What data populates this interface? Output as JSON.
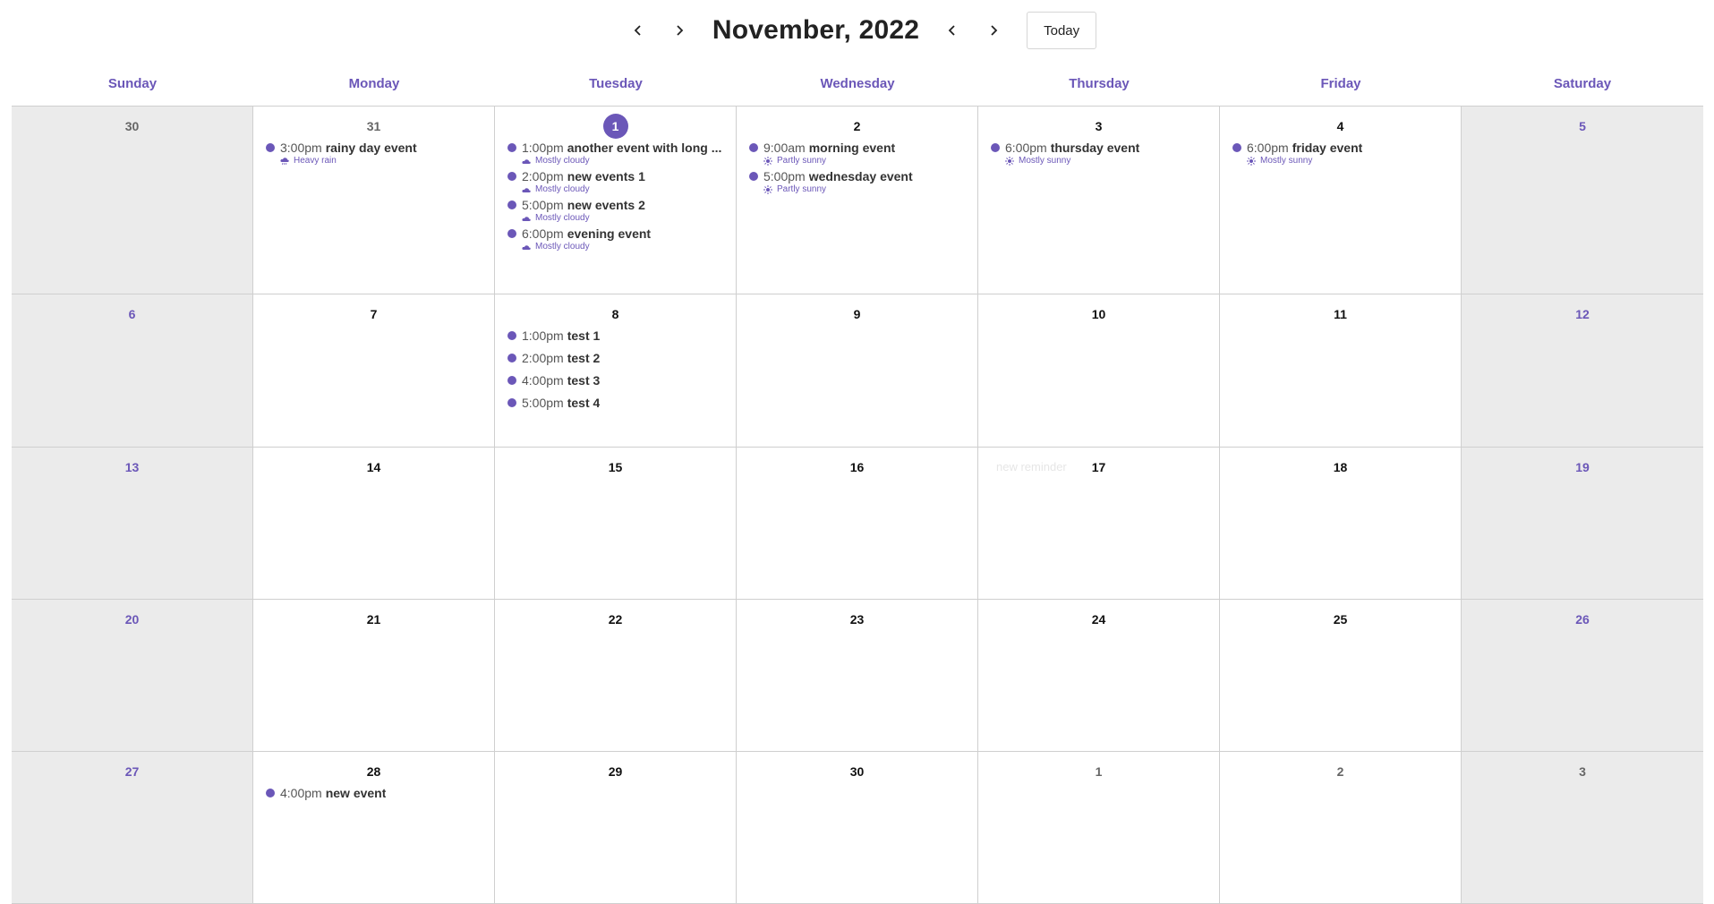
{
  "header": {
    "title": "November, 2022",
    "today_label": "Today",
    "prev_icon": "chevron-left-icon",
    "next_icon": "chevron-right-icon"
  },
  "weekdays": [
    "Sunday",
    "Monday",
    "Tuesday",
    "Wednesday",
    "Thursday",
    "Friday",
    "Saturday"
  ],
  "colors": {
    "accent": "#6b57b8",
    "weekend_bg": "#ebebeb",
    "border": "#cfcfcf"
  },
  "weeks": [
    [
      {
        "day": "30",
        "other": true,
        "weekend": true,
        "events": []
      },
      {
        "day": "31",
        "other": true,
        "events": [
          {
            "time": "3:00pm",
            "title": "rainy day event",
            "weather": "Heavy rain",
            "weather_icon": "rain-cloud-icon"
          }
        ]
      },
      {
        "day": "1",
        "today": true,
        "events": [
          {
            "time": "1:00pm",
            "title": "another event with long ...",
            "weather": "Mostly cloudy",
            "weather_icon": "cloud-icon"
          },
          {
            "time": "2:00pm",
            "title": "new events 1",
            "weather": "Mostly cloudy",
            "weather_icon": "cloud-icon"
          },
          {
            "time": "5:00pm",
            "title": "new events 2",
            "weather": "Mostly cloudy",
            "weather_icon": "cloud-icon"
          },
          {
            "time": "6:00pm",
            "title": "evening event",
            "weather": "Mostly cloudy",
            "weather_icon": "cloud-icon"
          }
        ]
      },
      {
        "day": "2",
        "events": [
          {
            "time": "9:00am",
            "title": "morning event",
            "weather": "Partly sunny",
            "weather_icon": "sun-icon"
          },
          {
            "time": "5:00pm",
            "title": "wednesday event",
            "weather": "Partly sunny",
            "weather_icon": "sun-icon"
          }
        ]
      },
      {
        "day": "3",
        "events": [
          {
            "time": "6:00pm",
            "title": "thursday event",
            "weather": "Mostly sunny",
            "weather_icon": "sun-icon"
          }
        ]
      },
      {
        "day": "4",
        "events": [
          {
            "time": "6:00pm",
            "title": "friday event",
            "weather": "Mostly sunny",
            "weather_icon": "sun-icon"
          }
        ]
      },
      {
        "day": "5",
        "weekend": true,
        "events": []
      }
    ],
    [
      {
        "day": "6",
        "weekend": true,
        "events": []
      },
      {
        "day": "7",
        "events": []
      },
      {
        "day": "8",
        "events": [
          {
            "time": "1:00pm",
            "title": "test 1"
          },
          {
            "time": "2:00pm",
            "title": "test 2"
          },
          {
            "time": "4:00pm",
            "title": "test 3"
          },
          {
            "time": "5:00pm",
            "title": "test 4"
          }
        ]
      },
      {
        "day": "9",
        "events": []
      },
      {
        "day": "10",
        "events": []
      },
      {
        "day": "11",
        "events": []
      },
      {
        "day": "12",
        "weekend": true,
        "events": []
      }
    ],
    [
      {
        "day": "13",
        "weekend": true,
        "events": []
      },
      {
        "day": "14",
        "events": []
      },
      {
        "day": "15",
        "events": []
      },
      {
        "day": "16",
        "events": []
      },
      {
        "day": "17",
        "ghost": "new reminder",
        "events": []
      },
      {
        "day": "18",
        "events": []
      },
      {
        "day": "19",
        "weekend": true,
        "events": []
      }
    ],
    [
      {
        "day": "20",
        "weekend": true,
        "events": []
      },
      {
        "day": "21",
        "events": []
      },
      {
        "day": "22",
        "events": []
      },
      {
        "day": "23",
        "events": []
      },
      {
        "day": "24",
        "events": []
      },
      {
        "day": "25",
        "events": []
      },
      {
        "day": "26",
        "weekend": true,
        "events": []
      }
    ],
    [
      {
        "day": "27",
        "weekend": true,
        "events": []
      },
      {
        "day": "28",
        "events": [
          {
            "time": "4:00pm",
            "title": "new event"
          }
        ]
      },
      {
        "day": "29",
        "events": []
      },
      {
        "day": "30",
        "events": []
      },
      {
        "day": "1",
        "other": true,
        "events": []
      },
      {
        "day": "2",
        "other": true,
        "events": []
      },
      {
        "day": "3",
        "other": true,
        "weekend": true,
        "events": []
      }
    ]
  ]
}
